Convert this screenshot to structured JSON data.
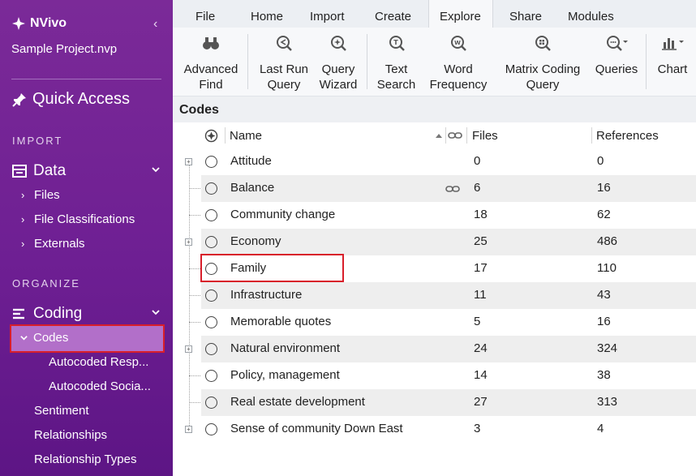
{
  "sidebar": {
    "app_name": "NVivo",
    "project": "Sample Project.nvp",
    "quick_access": "Quick Access",
    "section_import": "IMPORT",
    "data_group": "Data",
    "data_items": [
      "Files",
      "File Classifications",
      "Externals"
    ],
    "section_organize": "ORGANIZE",
    "coding_group": "Coding",
    "codes": "Codes",
    "codes_children": [
      "Autocoded Resp...",
      "Autocoded Socia..."
    ],
    "other_items": [
      "Sentiment",
      "Relationships",
      "Relationship Types"
    ]
  },
  "ribbon": {
    "tabs": [
      "File",
      "Home",
      "Import",
      "Create",
      "Explore",
      "Share",
      "Modules"
    ],
    "active_tab": "Explore",
    "buttons": [
      {
        "l1": "Advanced",
        "l2": "Find",
        "icon": "binoculars-icon"
      },
      {
        "l1": "Last Run",
        "l2": "Query",
        "icon": "last-run-query-icon"
      },
      {
        "l1": "Query",
        "l2": "Wizard",
        "icon": "query-wizard-icon"
      },
      {
        "l1": "Text",
        "l2": "Search",
        "icon": "text-search-icon"
      },
      {
        "l1": "Word",
        "l2": "Frequency",
        "icon": "word-frequency-icon"
      },
      {
        "l1": "Matrix Coding",
        "l2": "Query",
        "icon": "matrix-coding-icon"
      },
      {
        "l1": "Queries",
        "l2": "",
        "icon": "queries-icon"
      },
      {
        "l1": "Chart",
        "l2": "",
        "icon": "chart-icon"
      }
    ]
  },
  "list": {
    "title": "Codes",
    "columns": {
      "name": "Name",
      "files": "Files",
      "references": "References"
    },
    "rows": [
      {
        "name": "Attitude",
        "files": "0",
        "refs": "0",
        "expandable": true,
        "linked": false
      },
      {
        "name": "Balance",
        "files": "6",
        "refs": "16",
        "expandable": false,
        "linked": true
      },
      {
        "name": "Community change",
        "files": "18",
        "refs": "62",
        "expandable": false,
        "linked": false
      },
      {
        "name": "Economy",
        "files": "25",
        "refs": "486",
        "expandable": true,
        "linked": false
      },
      {
        "name": "Family",
        "files": "17",
        "refs": "110",
        "expandable": false,
        "linked": false
      },
      {
        "name": "Infrastructure",
        "files": "11",
        "refs": "43",
        "expandable": false,
        "linked": false
      },
      {
        "name": "Memorable quotes",
        "files": "5",
        "refs": "16",
        "expandable": false,
        "linked": false
      },
      {
        "name": "Natural environment",
        "files": "24",
        "refs": "324",
        "expandable": true,
        "linked": false
      },
      {
        "name": "Policy, management",
        "files": "14",
        "refs": "38",
        "expandable": false,
        "linked": false
      },
      {
        "name": "Real estate development",
        "files": "27",
        "refs": "313",
        "expandable": false,
        "linked": false
      },
      {
        "name": "Sense of community Down East",
        "files": "3",
        "refs": "4",
        "expandable": true,
        "linked": false
      }
    ]
  },
  "colors": {
    "sidebar": "#6e1f93",
    "selected": "#b26fc9",
    "highlight": "#d81e2a"
  }
}
